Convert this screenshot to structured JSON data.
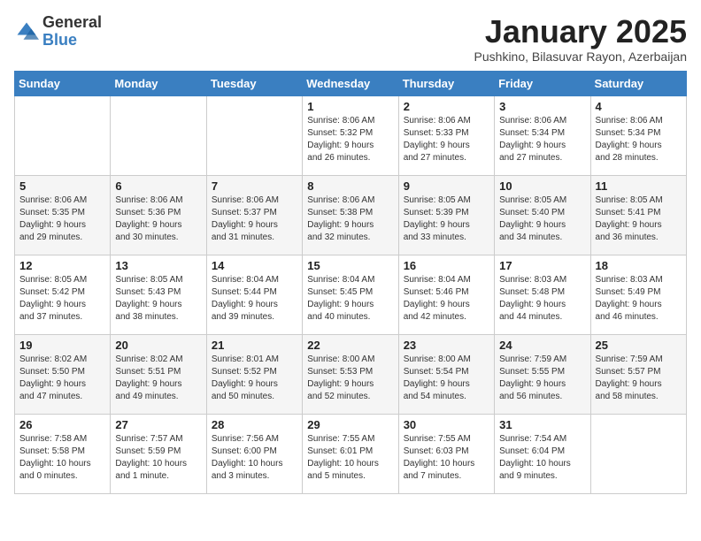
{
  "header": {
    "logo_general": "General",
    "logo_blue": "Blue",
    "month_title": "January 2025",
    "location": "Pushkino, Bilasuvar Rayon, Azerbaijan"
  },
  "weekdays": [
    "Sunday",
    "Monday",
    "Tuesday",
    "Wednesday",
    "Thursday",
    "Friday",
    "Saturday"
  ],
  "weeks": [
    [
      {
        "day": "",
        "info": ""
      },
      {
        "day": "",
        "info": ""
      },
      {
        "day": "",
        "info": ""
      },
      {
        "day": "1",
        "info": "Sunrise: 8:06 AM\nSunset: 5:32 PM\nDaylight: 9 hours\nand 26 minutes."
      },
      {
        "day": "2",
        "info": "Sunrise: 8:06 AM\nSunset: 5:33 PM\nDaylight: 9 hours\nand 27 minutes."
      },
      {
        "day": "3",
        "info": "Sunrise: 8:06 AM\nSunset: 5:34 PM\nDaylight: 9 hours\nand 27 minutes."
      },
      {
        "day": "4",
        "info": "Sunrise: 8:06 AM\nSunset: 5:34 PM\nDaylight: 9 hours\nand 28 minutes."
      }
    ],
    [
      {
        "day": "5",
        "info": "Sunrise: 8:06 AM\nSunset: 5:35 PM\nDaylight: 9 hours\nand 29 minutes."
      },
      {
        "day": "6",
        "info": "Sunrise: 8:06 AM\nSunset: 5:36 PM\nDaylight: 9 hours\nand 30 minutes."
      },
      {
        "day": "7",
        "info": "Sunrise: 8:06 AM\nSunset: 5:37 PM\nDaylight: 9 hours\nand 31 minutes."
      },
      {
        "day": "8",
        "info": "Sunrise: 8:06 AM\nSunset: 5:38 PM\nDaylight: 9 hours\nand 32 minutes."
      },
      {
        "day": "9",
        "info": "Sunrise: 8:05 AM\nSunset: 5:39 PM\nDaylight: 9 hours\nand 33 minutes."
      },
      {
        "day": "10",
        "info": "Sunrise: 8:05 AM\nSunset: 5:40 PM\nDaylight: 9 hours\nand 34 minutes."
      },
      {
        "day": "11",
        "info": "Sunrise: 8:05 AM\nSunset: 5:41 PM\nDaylight: 9 hours\nand 36 minutes."
      }
    ],
    [
      {
        "day": "12",
        "info": "Sunrise: 8:05 AM\nSunset: 5:42 PM\nDaylight: 9 hours\nand 37 minutes."
      },
      {
        "day": "13",
        "info": "Sunrise: 8:05 AM\nSunset: 5:43 PM\nDaylight: 9 hours\nand 38 minutes."
      },
      {
        "day": "14",
        "info": "Sunrise: 8:04 AM\nSunset: 5:44 PM\nDaylight: 9 hours\nand 39 minutes."
      },
      {
        "day": "15",
        "info": "Sunrise: 8:04 AM\nSunset: 5:45 PM\nDaylight: 9 hours\nand 40 minutes."
      },
      {
        "day": "16",
        "info": "Sunrise: 8:04 AM\nSunset: 5:46 PM\nDaylight: 9 hours\nand 42 minutes."
      },
      {
        "day": "17",
        "info": "Sunrise: 8:03 AM\nSunset: 5:48 PM\nDaylight: 9 hours\nand 44 minutes."
      },
      {
        "day": "18",
        "info": "Sunrise: 8:03 AM\nSunset: 5:49 PM\nDaylight: 9 hours\nand 46 minutes."
      }
    ],
    [
      {
        "day": "19",
        "info": "Sunrise: 8:02 AM\nSunset: 5:50 PM\nDaylight: 9 hours\nand 47 minutes."
      },
      {
        "day": "20",
        "info": "Sunrise: 8:02 AM\nSunset: 5:51 PM\nDaylight: 9 hours\nand 49 minutes."
      },
      {
        "day": "21",
        "info": "Sunrise: 8:01 AM\nSunset: 5:52 PM\nDaylight: 9 hours\nand 50 minutes."
      },
      {
        "day": "22",
        "info": "Sunrise: 8:00 AM\nSunset: 5:53 PM\nDaylight: 9 hours\nand 52 minutes."
      },
      {
        "day": "23",
        "info": "Sunrise: 8:00 AM\nSunset: 5:54 PM\nDaylight: 9 hours\nand 54 minutes."
      },
      {
        "day": "24",
        "info": "Sunrise: 7:59 AM\nSunset: 5:55 PM\nDaylight: 9 hours\nand 56 minutes."
      },
      {
        "day": "25",
        "info": "Sunrise: 7:59 AM\nSunset: 5:57 PM\nDaylight: 9 hours\nand 58 minutes."
      }
    ],
    [
      {
        "day": "26",
        "info": "Sunrise: 7:58 AM\nSunset: 5:58 PM\nDaylight: 10 hours\nand 0 minutes."
      },
      {
        "day": "27",
        "info": "Sunrise: 7:57 AM\nSunset: 5:59 PM\nDaylight: 10 hours\nand 1 minute."
      },
      {
        "day": "28",
        "info": "Sunrise: 7:56 AM\nSunset: 6:00 PM\nDaylight: 10 hours\nand 3 minutes."
      },
      {
        "day": "29",
        "info": "Sunrise: 7:55 AM\nSunset: 6:01 PM\nDaylight: 10 hours\nand 5 minutes."
      },
      {
        "day": "30",
        "info": "Sunrise: 7:55 AM\nSunset: 6:03 PM\nDaylight: 10 hours\nand 7 minutes."
      },
      {
        "day": "31",
        "info": "Sunrise: 7:54 AM\nSunset: 6:04 PM\nDaylight: 10 hours\nand 9 minutes."
      },
      {
        "day": "",
        "info": ""
      }
    ]
  ]
}
